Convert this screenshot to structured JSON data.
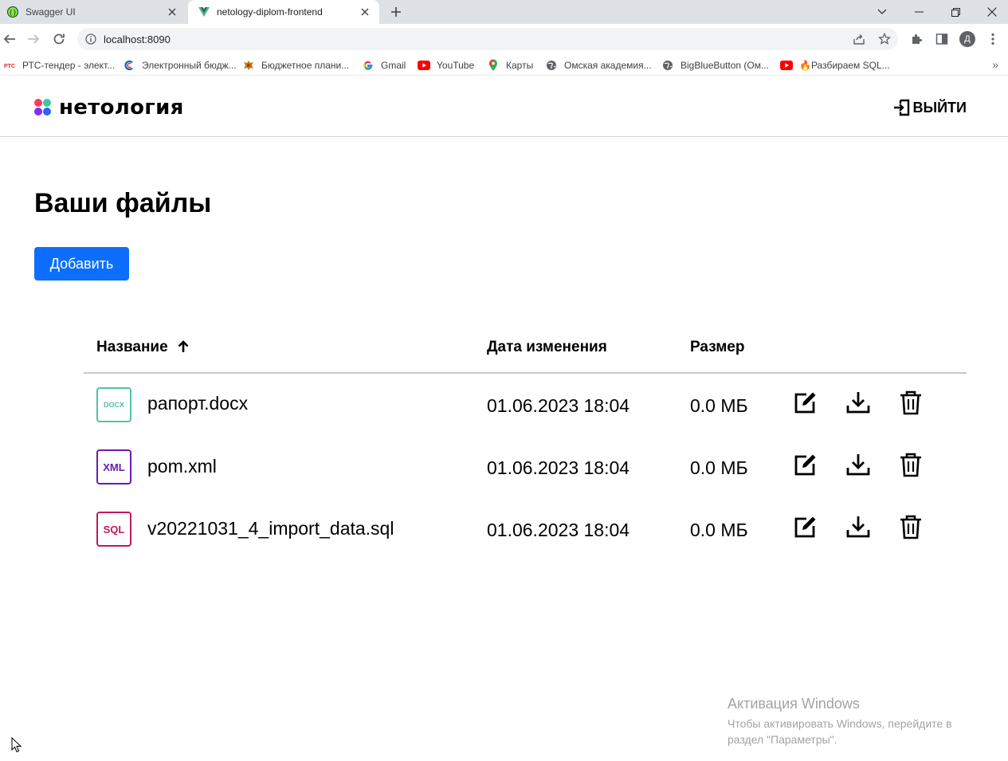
{
  "browser": {
    "tabs": [
      {
        "title": "Swagger UI",
        "favicon": "swagger-icon"
      },
      {
        "title": "netology-diplom-frontend",
        "favicon": "vue-icon"
      }
    ],
    "address": "localhost:8090",
    "profile_initial": "Д",
    "bookmarks": [
      {
        "label": "РТС-тендер - элект...",
        "icon": "rts-icon"
      },
      {
        "label": "Электронный бюдж...",
        "icon": "budget-icon"
      },
      {
        "label": "Бюджетное плани...",
        "icon": "emblem-icon"
      },
      {
        "label": "Gmail",
        "icon": "google-icon"
      },
      {
        "label": "YouTube",
        "icon": "youtube-icon"
      },
      {
        "label": "Карты",
        "icon": "maps-icon"
      },
      {
        "label": "Омская академия...",
        "icon": "globe-icon"
      },
      {
        "label": "BigBlueButton (Ом...",
        "icon": "globe-icon"
      },
      {
        "label": "🔥Разбираем SQL...",
        "icon": "youtube-icon"
      }
    ],
    "bookmarks_more": "»"
  },
  "header": {
    "logo_text": "нетология",
    "logout_label": "ВЫЙТИ"
  },
  "main": {
    "title": "Ваши файлы",
    "add_button": "Добавить",
    "columns": {
      "name": "Название",
      "date": "Дата изменения",
      "size": "Размер"
    },
    "files": [
      {
        "type": "DOCX",
        "color": "#4fc3a1",
        "name": "рапорт.docx",
        "date": "01.06.2023 18:04",
        "size": "0.0 МБ"
      },
      {
        "type": "XML",
        "color": "#6a1bb5",
        "name": "pom.xml",
        "date": "01.06.2023 18:04",
        "size": "0.0 МБ"
      },
      {
        "type": "SQL",
        "color": "#c2185b",
        "name": "v20221031_4_import_data.sql",
        "date": "01.06.2023 18:04",
        "size": "0.0 МБ"
      }
    ]
  },
  "watermark": {
    "title": "Активация Windows",
    "text": "Чтобы активировать Windows, перейдите в раздел \"Параметры\"."
  },
  "colors": {
    "primary": "#0d6efd",
    "logo_dots": [
      "#ff3b5c",
      "#3cc8a5",
      "#7b2ff7",
      "#2962ff"
    ]
  }
}
